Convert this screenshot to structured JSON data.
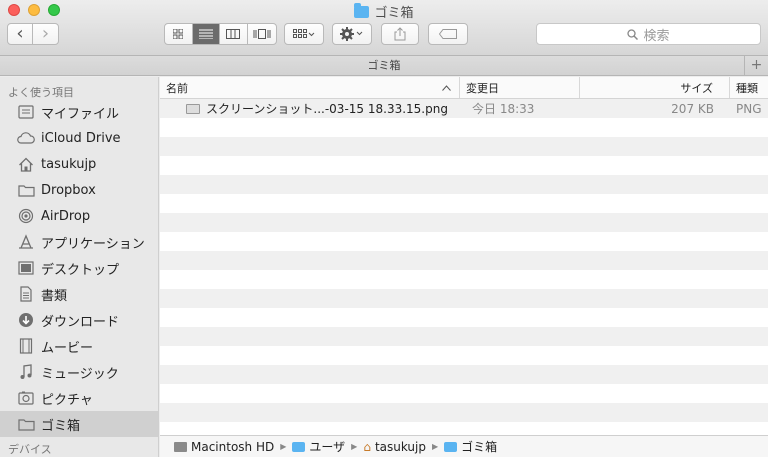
{
  "window": {
    "title": "ゴミ箱"
  },
  "toolbar": {
    "back": "‹",
    "forward": "›",
    "search_placeholder": "検索"
  },
  "tabbar": {
    "label": "ゴミ箱",
    "plus": "+"
  },
  "sidebar": {
    "heading": "よく使う項目",
    "items": [
      {
        "label": "マイファイル",
        "icon": "all-files-icon"
      },
      {
        "label": "iCloud Drive",
        "icon": "cloud-icon"
      },
      {
        "label": "tasukujp",
        "icon": "home-icon"
      },
      {
        "label": "Dropbox",
        "icon": "folder-icon"
      },
      {
        "label": "AirDrop",
        "icon": "airdrop-icon"
      },
      {
        "label": "アプリケーション",
        "icon": "applications-icon"
      },
      {
        "label": "デスクトップ",
        "icon": "desktop-icon"
      },
      {
        "label": "書類",
        "icon": "documents-icon"
      },
      {
        "label": "ダウンロード",
        "icon": "download-icon"
      },
      {
        "label": "ムービー",
        "icon": "movies-icon"
      },
      {
        "label": "ミュージック",
        "icon": "music-icon"
      },
      {
        "label": "ピクチャ",
        "icon": "pictures-icon"
      },
      {
        "label": "ゴミ箱",
        "icon": "folder-icon"
      }
    ],
    "footer": "デバイス"
  },
  "columns": {
    "name": "名前",
    "date": "変更日",
    "size": "サイズ",
    "kind": "種類"
  },
  "files": [
    {
      "name": "スクリーンショット...-03-15 18.33.15.png",
      "date": "今日 18:33",
      "size": "207 KB",
      "kind": "PNG"
    }
  ],
  "pathbar": [
    {
      "label": "Macintosh HD",
      "icon": "hard-drive-icon"
    },
    {
      "label": "ユーザ",
      "icon": "folder-icon"
    },
    {
      "label": "tasukujp",
      "icon": "home-icon"
    },
    {
      "label": "ゴミ箱",
      "icon": "folder-icon"
    }
  ]
}
